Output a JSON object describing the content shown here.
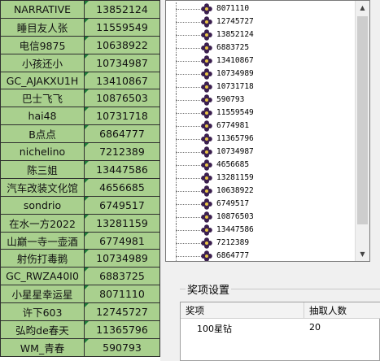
{
  "sheet": {
    "rows": [
      {
        "name": "NARRATIVE",
        "id": "13852124"
      },
      {
        "name": "睡目友人张",
        "id": "11559549"
      },
      {
        "name": "电信9875",
        "id": "10638922"
      },
      {
        "name": "小孩还小",
        "id": "10734987"
      },
      {
        "name": "GC_AJAKXU1H",
        "id": "13410867"
      },
      {
        "name": "巴士飞飞",
        "id": "10876503"
      },
      {
        "name": "hai48",
        "id": "10731718"
      },
      {
        "name": "B点点",
        "id": "6864777"
      },
      {
        "name": "nichelino",
        "id": "7212389"
      },
      {
        "name": "陈三姐",
        "id": "13447586"
      },
      {
        "name": "汽车改装文化馆",
        "id": "4656685"
      },
      {
        "name": "sondrio",
        "id": "6749517"
      },
      {
        "name": "在水一方2022",
        "id": "13281159"
      },
      {
        "name": "山巅一寺一壶酒",
        "id": "6774981"
      },
      {
        "name": "射伤打毒鹅",
        "id": "10734989"
      },
      {
        "name": "GC_RWZA40I0",
        "id": "6883725"
      },
      {
        "name": "小星星幸运星",
        "id": "8071110"
      },
      {
        "name": "许下603",
        "id": "12745727"
      },
      {
        "name": "弘昀de春天",
        "id": "11365796"
      },
      {
        "name": "WM_青春",
        "id": "590793"
      }
    ]
  },
  "listbox": {
    "items": [
      "8071110",
      "12745727",
      "13852124",
      "6883725",
      "13410867",
      "10734989",
      "10731718",
      "590793",
      "11559549",
      "6774981",
      "11365796",
      "10734987",
      "4656685",
      "13281159",
      "10638922",
      "6749517",
      "10876503",
      "13447586",
      "7212389",
      "6864777"
    ],
    "scroll_up_glyph": "▲",
    "scroll_down_glyph": "▼",
    "item_icon": "flower-icon"
  },
  "prize_settings": {
    "group_title": "奖项设置",
    "columns": [
      "奖项",
      "抽取人数"
    ],
    "rows": [
      {
        "prize": "100星钻",
        "count": "20"
      }
    ]
  },
  "colors": {
    "cell_fill": "#a9d08e",
    "flower_purple": "#3b1f4f",
    "flower_center": "#e8c547"
  }
}
